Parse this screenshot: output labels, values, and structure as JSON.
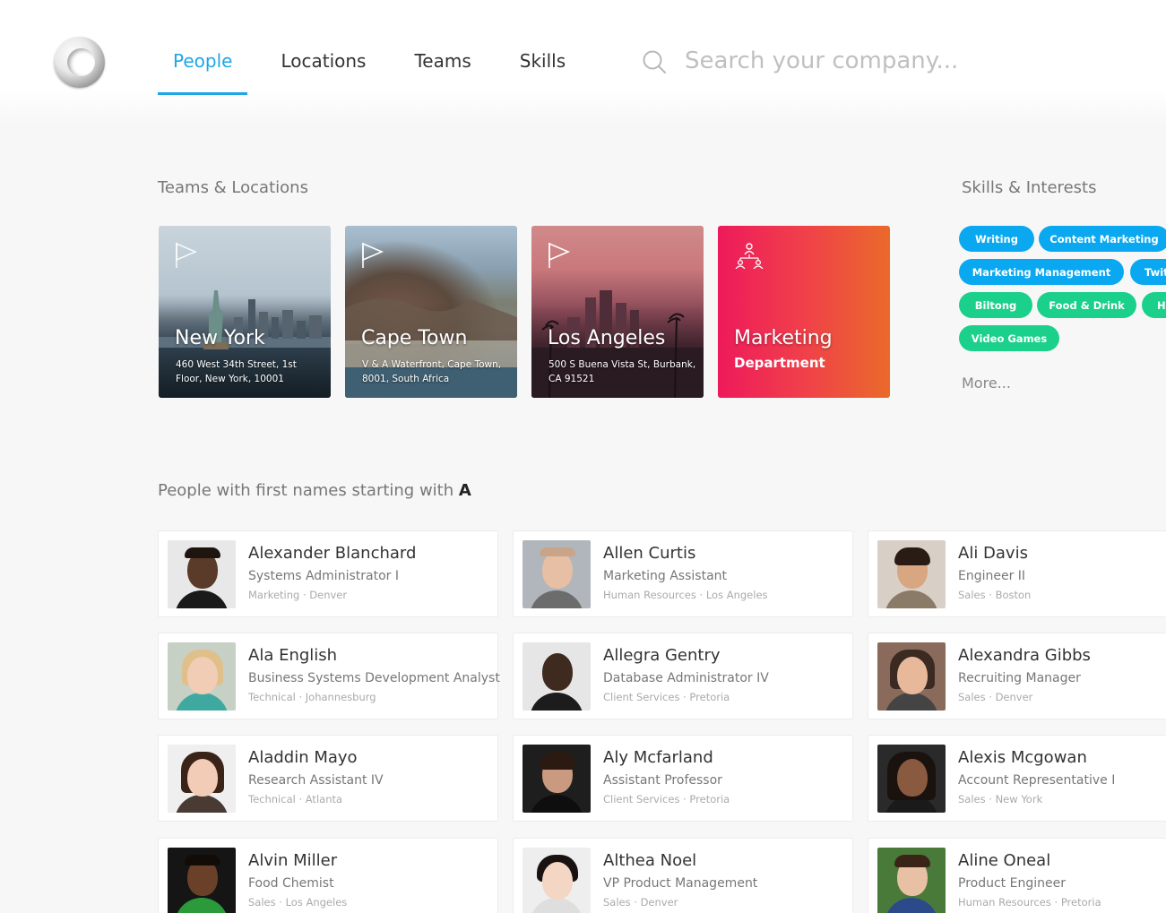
{
  "nav": {
    "tabs": [
      {
        "label": "People",
        "active": true
      },
      {
        "label": "Locations",
        "active": false
      },
      {
        "label": "Teams",
        "active": false
      },
      {
        "label": "Skills",
        "active": false
      }
    ],
    "search_placeholder": "Search your company...",
    "accent_color": "#1fa6e6"
  },
  "teams_locations": {
    "title": "Teams & Locations",
    "cards": [
      {
        "name": "New York",
        "address": "460 West 34th Street, 1st Floor, New York, 10001",
        "icon": "flag-icon"
      },
      {
        "name": "Cape Town",
        "address": "V & A Waterfront, Cape Town, 8001, South Africa",
        "icon": "flag-icon"
      },
      {
        "name": "Los Angeles",
        "address": "500 S Buena Vista St, Burbank, CA 91521",
        "icon": "flag-icon"
      },
      {
        "name": "Marketing",
        "subtitle": "Department",
        "icon": "team-icon"
      }
    ]
  },
  "skills": {
    "title": "Skills & Interests",
    "tags": [
      {
        "label": "Writing",
        "color": "#0aa8f0"
      },
      {
        "label": "Content Marketing",
        "color": "#0aa8f0"
      },
      {
        "label": "Marketing Management",
        "color": "#0aa8f0"
      },
      {
        "label": "Twitter",
        "color": "#0aa8f0"
      },
      {
        "label": "Biltong",
        "color": "#1bd08a"
      },
      {
        "label": "Food & Drink",
        "color": "#1bd08a"
      },
      {
        "label": "Hiking",
        "color": "#1bd08a"
      },
      {
        "label": "Video Games",
        "color": "#1bd08a"
      }
    ],
    "more_label": "More..."
  },
  "people": {
    "title_prefix": "People with first names starting with",
    "letter": "A",
    "list": [
      {
        "name": "Alexander Blanchard",
        "role": "Systems Administrator I",
        "meta": "Marketing · Denver"
      },
      {
        "name": "Allen Curtis",
        "role": "Marketing Assistant",
        "meta": "Human Resources · Los Angeles"
      },
      {
        "name": "Ali Davis",
        "role": "Engineer II",
        "meta": "Sales · Boston"
      },
      {
        "name": "Ala English",
        "role": "Business Systems Development Analyst",
        "meta": "Technical · Johannesburg"
      },
      {
        "name": "Allegra Gentry",
        "role": "Database Administrator IV",
        "meta": "Client Services · Pretoria"
      },
      {
        "name": "Alexandra Gibbs",
        "role": "Recruiting Manager",
        "meta": "Sales · Denver"
      },
      {
        "name": "Aladdin Mayo",
        "role": "Research Assistant IV",
        "meta": "Technical · Atlanta"
      },
      {
        "name": "Aly Mcfarland",
        "role": "Assistant Professor",
        "meta": "Client Services · Pretoria"
      },
      {
        "name": "Alexis Mcgowan",
        "role": "Account Representative I",
        "meta": "Sales · New York"
      },
      {
        "name": "Alvin Miller",
        "role": "Food Chemist",
        "meta": "Sales · Los Angeles"
      },
      {
        "name": "Althea Noel",
        "role": "VP Product Management",
        "meta": "Sales · Denver"
      },
      {
        "name": "Aline Oneal",
        "role": "Product Engineer",
        "meta": "Human Resources · Pretoria"
      }
    ]
  }
}
